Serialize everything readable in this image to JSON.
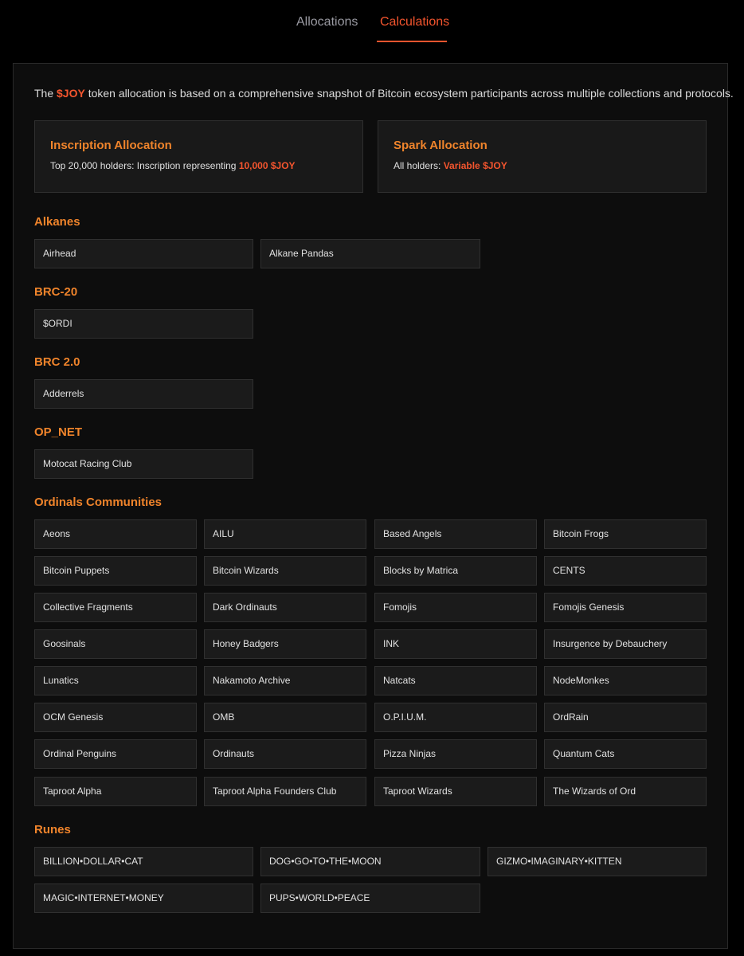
{
  "tabs": {
    "allocations": "Allocations",
    "calculations": "Calculations"
  },
  "intro": {
    "pre": "The ",
    "token": "$JOY",
    "post": " token allocation is based on a comprehensive snapshot of Bitcoin ecosystem participants across multiple collections and protocols."
  },
  "cards": {
    "inscription": {
      "title": "Inscription Allocation",
      "desc_pre": "Top 20,000 holders: Inscription representing ",
      "desc_value": "10,000 $JOY"
    },
    "spark": {
      "title": "Spark Allocation",
      "desc_pre": "All holders: ",
      "desc_value": "Variable $JOY"
    }
  },
  "sections": {
    "alkanes": {
      "title": "Alkanes",
      "items": [
        "Airhead",
        "Alkane Pandas"
      ]
    },
    "brc20": {
      "title": "BRC-20",
      "items": [
        "$ORDI"
      ]
    },
    "brc2": {
      "title": "BRC 2.0",
      "items": [
        "Adderrels"
      ]
    },
    "opnet": {
      "title": "OP_NET",
      "items": [
        "Motocat Racing Club"
      ]
    },
    "ordinals": {
      "title": "Ordinals Communities",
      "items": [
        "Aeons",
        "AILU",
        "Based Angels",
        "Bitcoin Frogs",
        "Bitcoin Puppets",
        "Bitcoin Wizards",
        "Blocks by Matrica",
        "CENTS",
        "Collective Fragments",
        "Dark Ordinauts",
        "Fomojis",
        "Fomojis Genesis",
        "Goosinals",
        "Honey Badgers",
        "INK",
        "Insurgence by Debauchery",
        "Lunatics",
        "Nakamoto Archive",
        "Natcats",
        "NodeMonkes",
        "OCM Genesis",
        "OMB",
        "O.P.I.U.M.",
        "OrdRain",
        "Ordinal Penguins",
        "Ordinauts",
        "Pizza Ninjas",
        "Quantum Cats",
        "Taproot Alpha",
        "Taproot Alpha Founders Club",
        "Taproot Wizards",
        "The Wizards of Ord"
      ]
    },
    "runes": {
      "title": "Runes",
      "items": [
        "BILLION•DOLLAR•CAT",
        "DOG•GO•TO•THE•MOON",
        "GIZMO•IMAGINARY•KITTEN",
        "MAGIC•INTERNET•MONEY",
        "PUPS•WORLD•PEACE"
      ]
    }
  }
}
